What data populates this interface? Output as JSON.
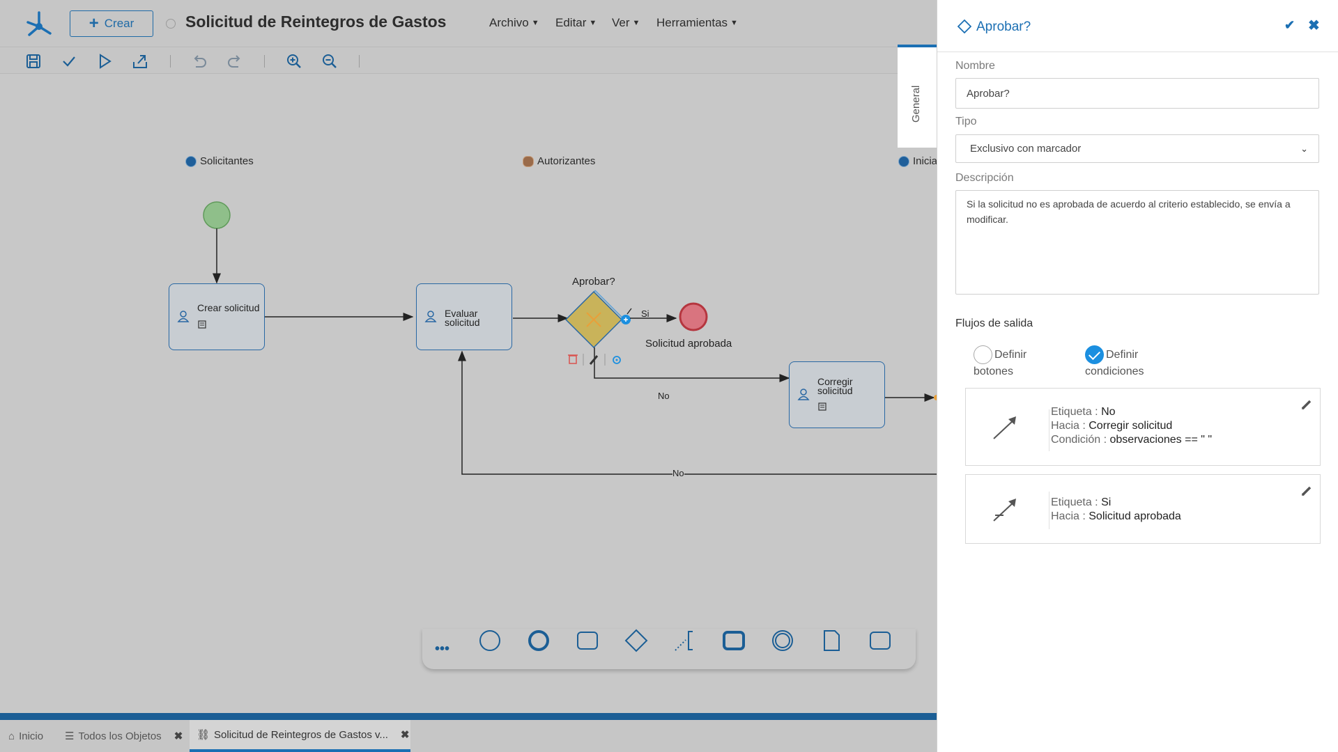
{
  "app": {
    "create_label": "Crear",
    "document_title": "Solicitud de Reintegros de Gastos",
    "menus": [
      "Archivo",
      "Editar",
      "Ver",
      "Herramientas"
    ]
  },
  "toolbar": {
    "icons": [
      "save-icon",
      "check-icon",
      "play-icon",
      "export-icon",
      "undo-icon",
      "redo-icon",
      "zoom-in-icon",
      "zoom-out-icon"
    ]
  },
  "diagram": {
    "lanes": [
      "Solicitantes",
      "Autorizantes",
      "Inicia"
    ],
    "tasks": {
      "crear": "Crear solicitud",
      "evaluar": [
        "Evaluar",
        "solicitud"
      ],
      "corregir": [
        "Corregir",
        "solicitud"
      ]
    },
    "gateway_label": "Aprobar?",
    "end_label": "Solicitud aprobada",
    "flow_labels": {
      "si": "Si",
      "no_1": "No",
      "no_2": "No"
    }
  },
  "side_tab": {
    "label": "General"
  },
  "panel": {
    "title": "Aprobar?",
    "nombre": {
      "label": "Nombre",
      "value": "Aprobar?"
    },
    "tipo": {
      "label": "Tipo",
      "value": "Exclusivo con marcador"
    },
    "descripcion": {
      "label": "Descripción",
      "value": "Si la solicitud no es aprobada de acuerdo al criterio establecido, se envía a modificar."
    },
    "flujos": {
      "title": "Flujos de salida",
      "option_botones": [
        "Definir",
        "botones"
      ],
      "option_condiciones": [
        "Definir",
        "condiciones"
      ],
      "selected": "condiciones",
      "flows": [
        {
          "etiqueta_k": "Etiqueta :",
          "etiqueta": "No",
          "hacia_k": "Hacia :",
          "hacia": "Corregir solicitud",
          "condicion_k": "Condición :",
          "condicion": "observaciones == \" \""
        },
        {
          "etiqueta_k": "Etiqueta :",
          "etiqueta": "Si",
          "hacia_k": "Hacia :",
          "hacia": "Solicitud aprobada"
        }
      ]
    }
  },
  "tabs": [
    {
      "label": "Inicio"
    },
    {
      "label": "Todos los Objetos"
    },
    {
      "label": "Solicitud de Reintegros de Gastos v..."
    }
  ],
  "colors": {
    "accent": "#1b6fb3",
    "start_event": "#8fbf8a",
    "end_event": "#d9747f",
    "gateway": "#c9b35a"
  }
}
